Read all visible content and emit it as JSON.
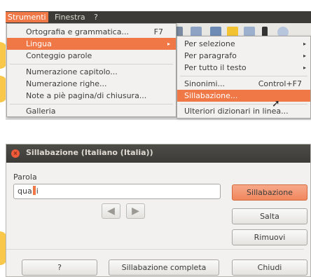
{
  "menubar": {
    "items": [
      "Strumenti",
      "Finestra",
      "?"
    ]
  },
  "strumenti_menu": {
    "items": [
      {
        "label": "Ortografia e grammatica...",
        "shortcut": "F7"
      },
      {
        "label": "Lingua",
        "arrow": "▸"
      },
      {
        "label": "Conteggio parole"
      },
      {
        "label": "Numerazione capitolo..."
      },
      {
        "label": "Numerazione righe..."
      },
      {
        "label": "Note a piè pagina/di chiusura..."
      },
      {
        "label": "Galleria"
      }
    ]
  },
  "lingua_submenu": {
    "items": [
      {
        "label": "Per selezione",
        "arrow": "▸"
      },
      {
        "label": "Per paragrafo",
        "arrow": "▸"
      },
      {
        "label": "Per tutto il testo",
        "arrow": "▸"
      },
      {
        "label": "Sinonimi...",
        "shortcut": "Control+F7"
      },
      {
        "label": "Sillabazione..."
      },
      {
        "label": "Ulteriori dizionari in linea..."
      }
    ]
  },
  "dialog": {
    "title": "Sillabazione (Italiano (Italia))",
    "word_label": "Parola",
    "word_value_before": "qua",
    "word_value_after": "i",
    "buttons": {
      "hyphenate": "Sillabazione",
      "skip": "Salta",
      "remove": "Rimuovi",
      "help": "?",
      "hyphenate_all": "Sillabazione completa",
      "close": "Chiudi"
    }
  },
  "icons": {
    "close": "close-icon",
    "left_arrow": "arrow-left-icon",
    "right_arrow": "arrow-right-icon",
    "pointer": "mouse-pointer-icon"
  },
  "colors": {
    "accent": "#f07746",
    "menubar": "#3c3b37",
    "menu_bg": "#f2f1f0",
    "blob": "#f9c84a"
  }
}
